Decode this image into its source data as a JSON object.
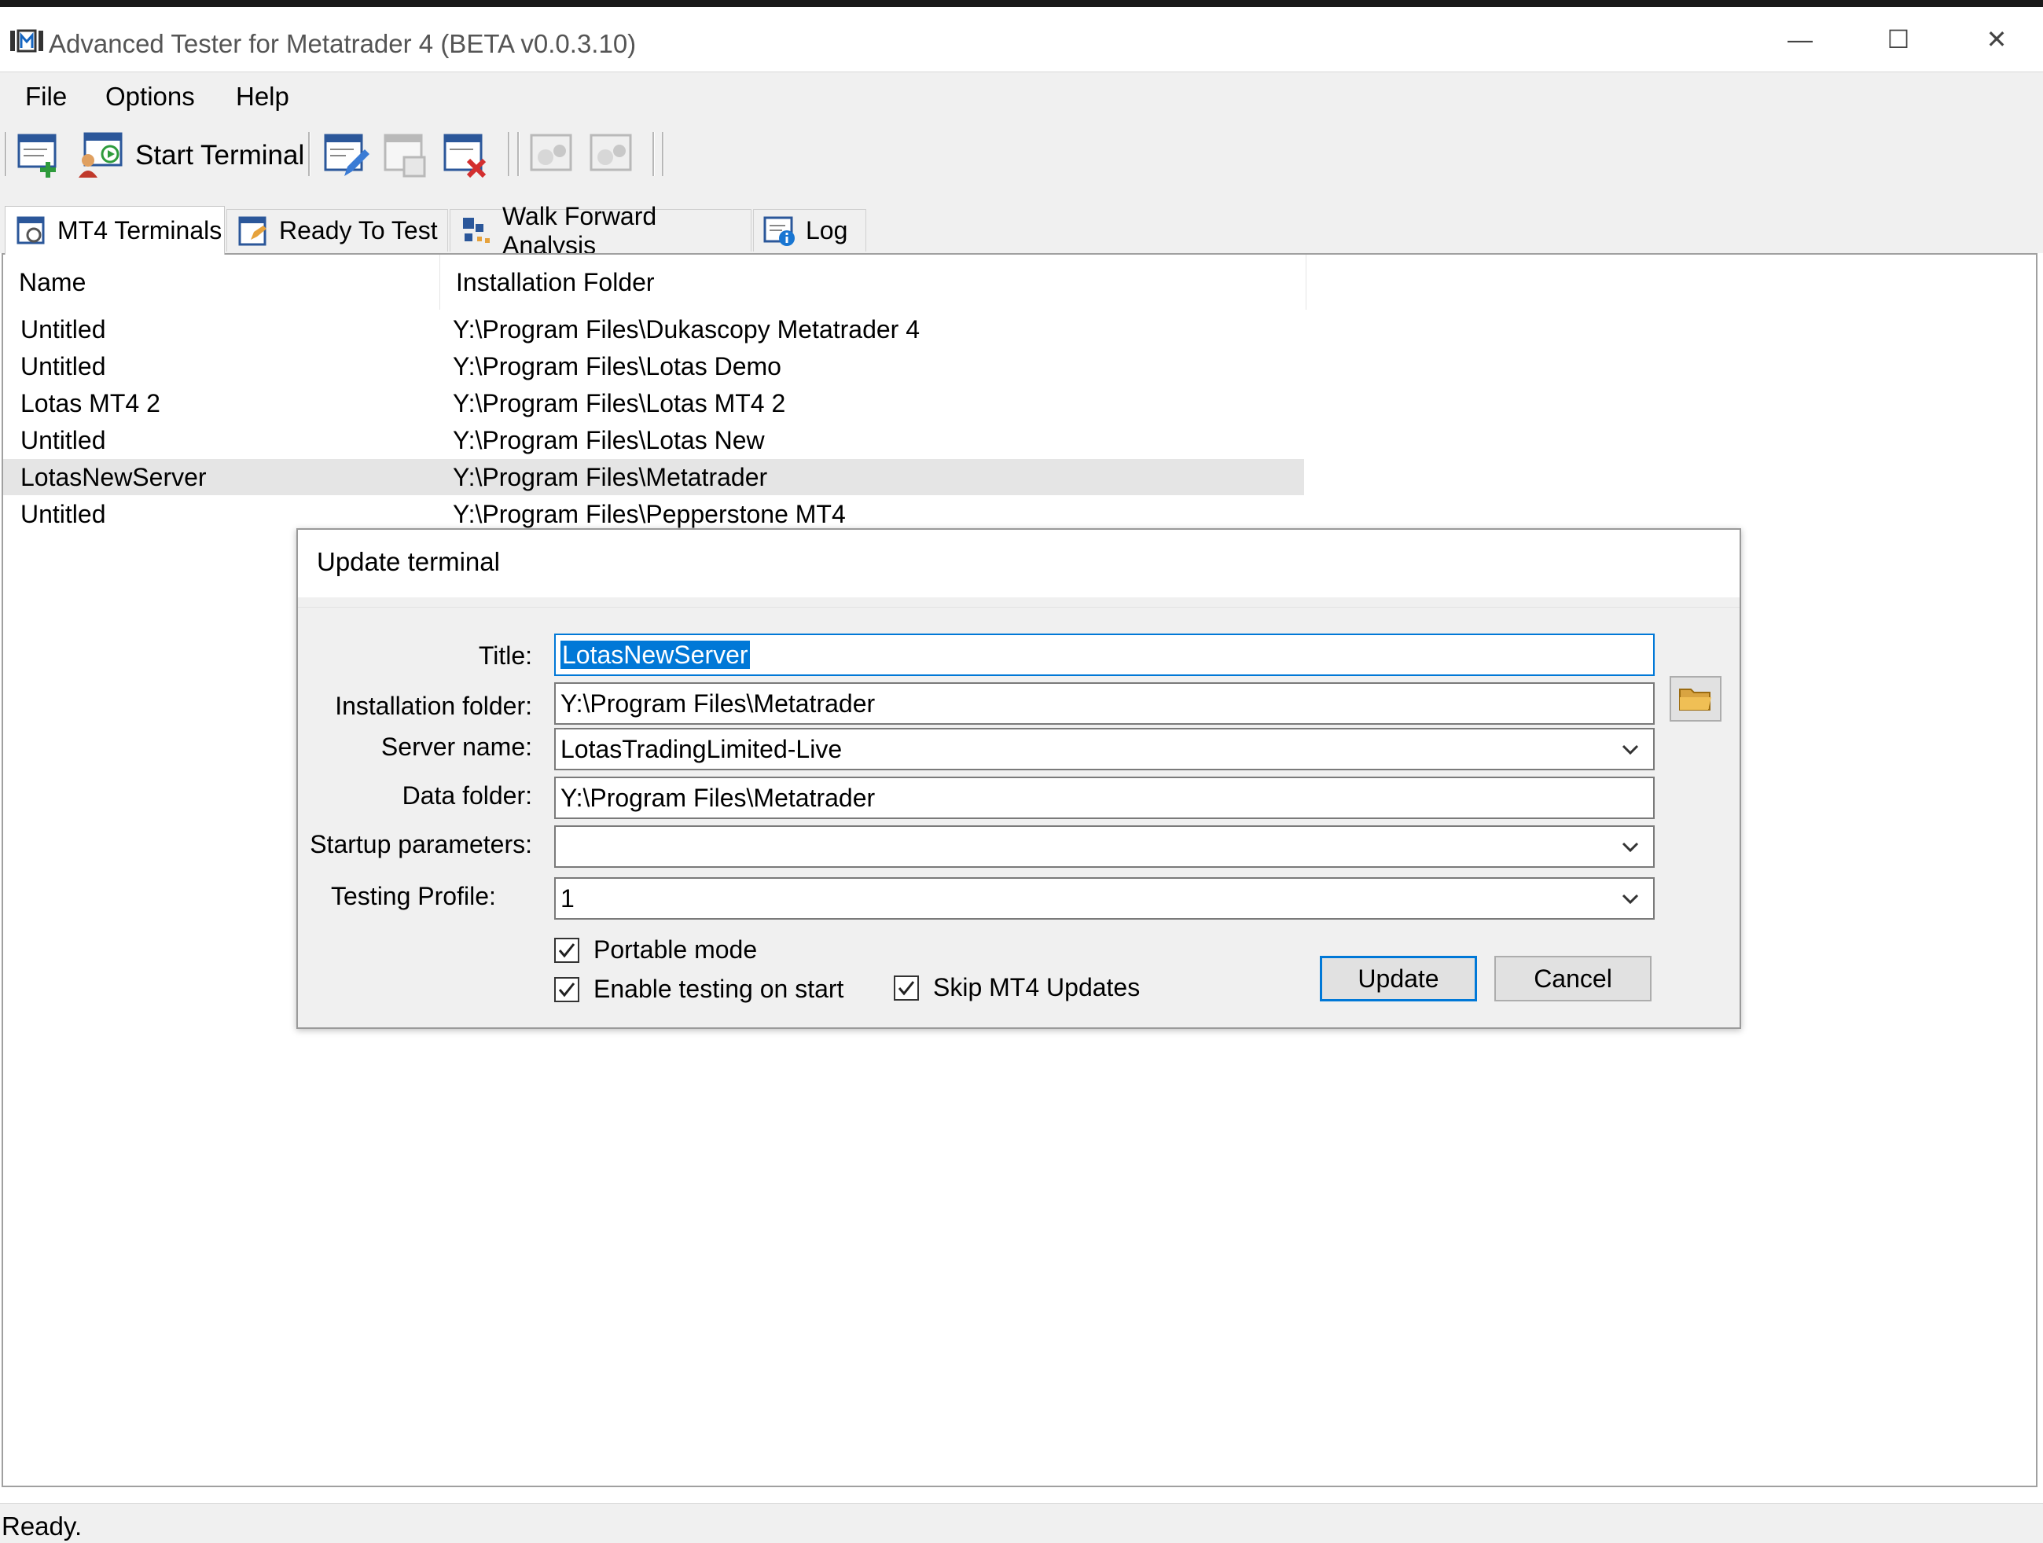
{
  "window": {
    "title": "Advanced Tester for Metatrader 4 (BETA v0.0.3.10)",
    "minimize_glyph": "—",
    "maximize_glyph": "☐",
    "close_glyph": "✕"
  },
  "menu": {
    "items": [
      "File",
      "Options",
      "Help"
    ]
  },
  "toolbar": {
    "start_terminal_label": "Start Terminal"
  },
  "tabs": [
    {
      "label": "MT4 Terminals",
      "icon": "terminals-tab-icon",
      "active": true
    },
    {
      "label": "Ready To Test",
      "icon": "ready-to-test-tab-icon",
      "active": false
    },
    {
      "label": "Walk Forward Analysis",
      "icon": "walk-forward-tab-icon",
      "active": false
    },
    {
      "label": "Log",
      "icon": "log-tab-icon",
      "active": false
    }
  ],
  "table": {
    "columns": [
      "Name",
      "Installation Folder"
    ],
    "rows": [
      {
        "name": "Untitled",
        "folder": "Y:\\Program Files\\Dukascopy Metatrader 4"
      },
      {
        "name": "Untitled",
        "folder": "Y:\\Program Files\\Lotas Demo"
      },
      {
        "name": "Lotas MT4 2",
        "folder": "Y:\\Program Files\\Lotas MT4 2"
      },
      {
        "name": "Untitled",
        "folder": "Y:\\Program Files\\Lotas New"
      },
      {
        "name": "LotasNewServer",
        "folder": "Y:\\Program Files\\Metatrader",
        "selected": true
      },
      {
        "name": "Untitled",
        "folder": "Y:\\Program Files\\Pepperstone MT4"
      }
    ]
  },
  "dialog": {
    "title": "Update terminal",
    "labels": {
      "title": "Title:",
      "installation_folder": "Installation folder:",
      "server_name": "Server name:",
      "data_folder": "Data folder:",
      "startup_parameters": "Startup parameters:",
      "testing_profile": "Testing Profile:"
    },
    "values": {
      "title": "LotasNewServer",
      "installation_folder": "Y:\\Program Files\\Metatrader",
      "server_name": "LotasTradingLimited-Live",
      "data_folder": "Y:\\Program Files\\Metatrader",
      "startup_parameters": "",
      "testing_profile": "1"
    },
    "checkboxes": {
      "portable_mode": "Portable mode",
      "enable_testing": "Enable testing on start",
      "skip_updates": "Skip MT4 Updates"
    },
    "buttons": {
      "update": "Update",
      "cancel": "Cancel"
    }
  },
  "status": {
    "text": "Ready."
  },
  "colors": {
    "accent": "#0078d7",
    "chrome": "#f0f0f0",
    "selected_row": "#e5e5e5"
  }
}
